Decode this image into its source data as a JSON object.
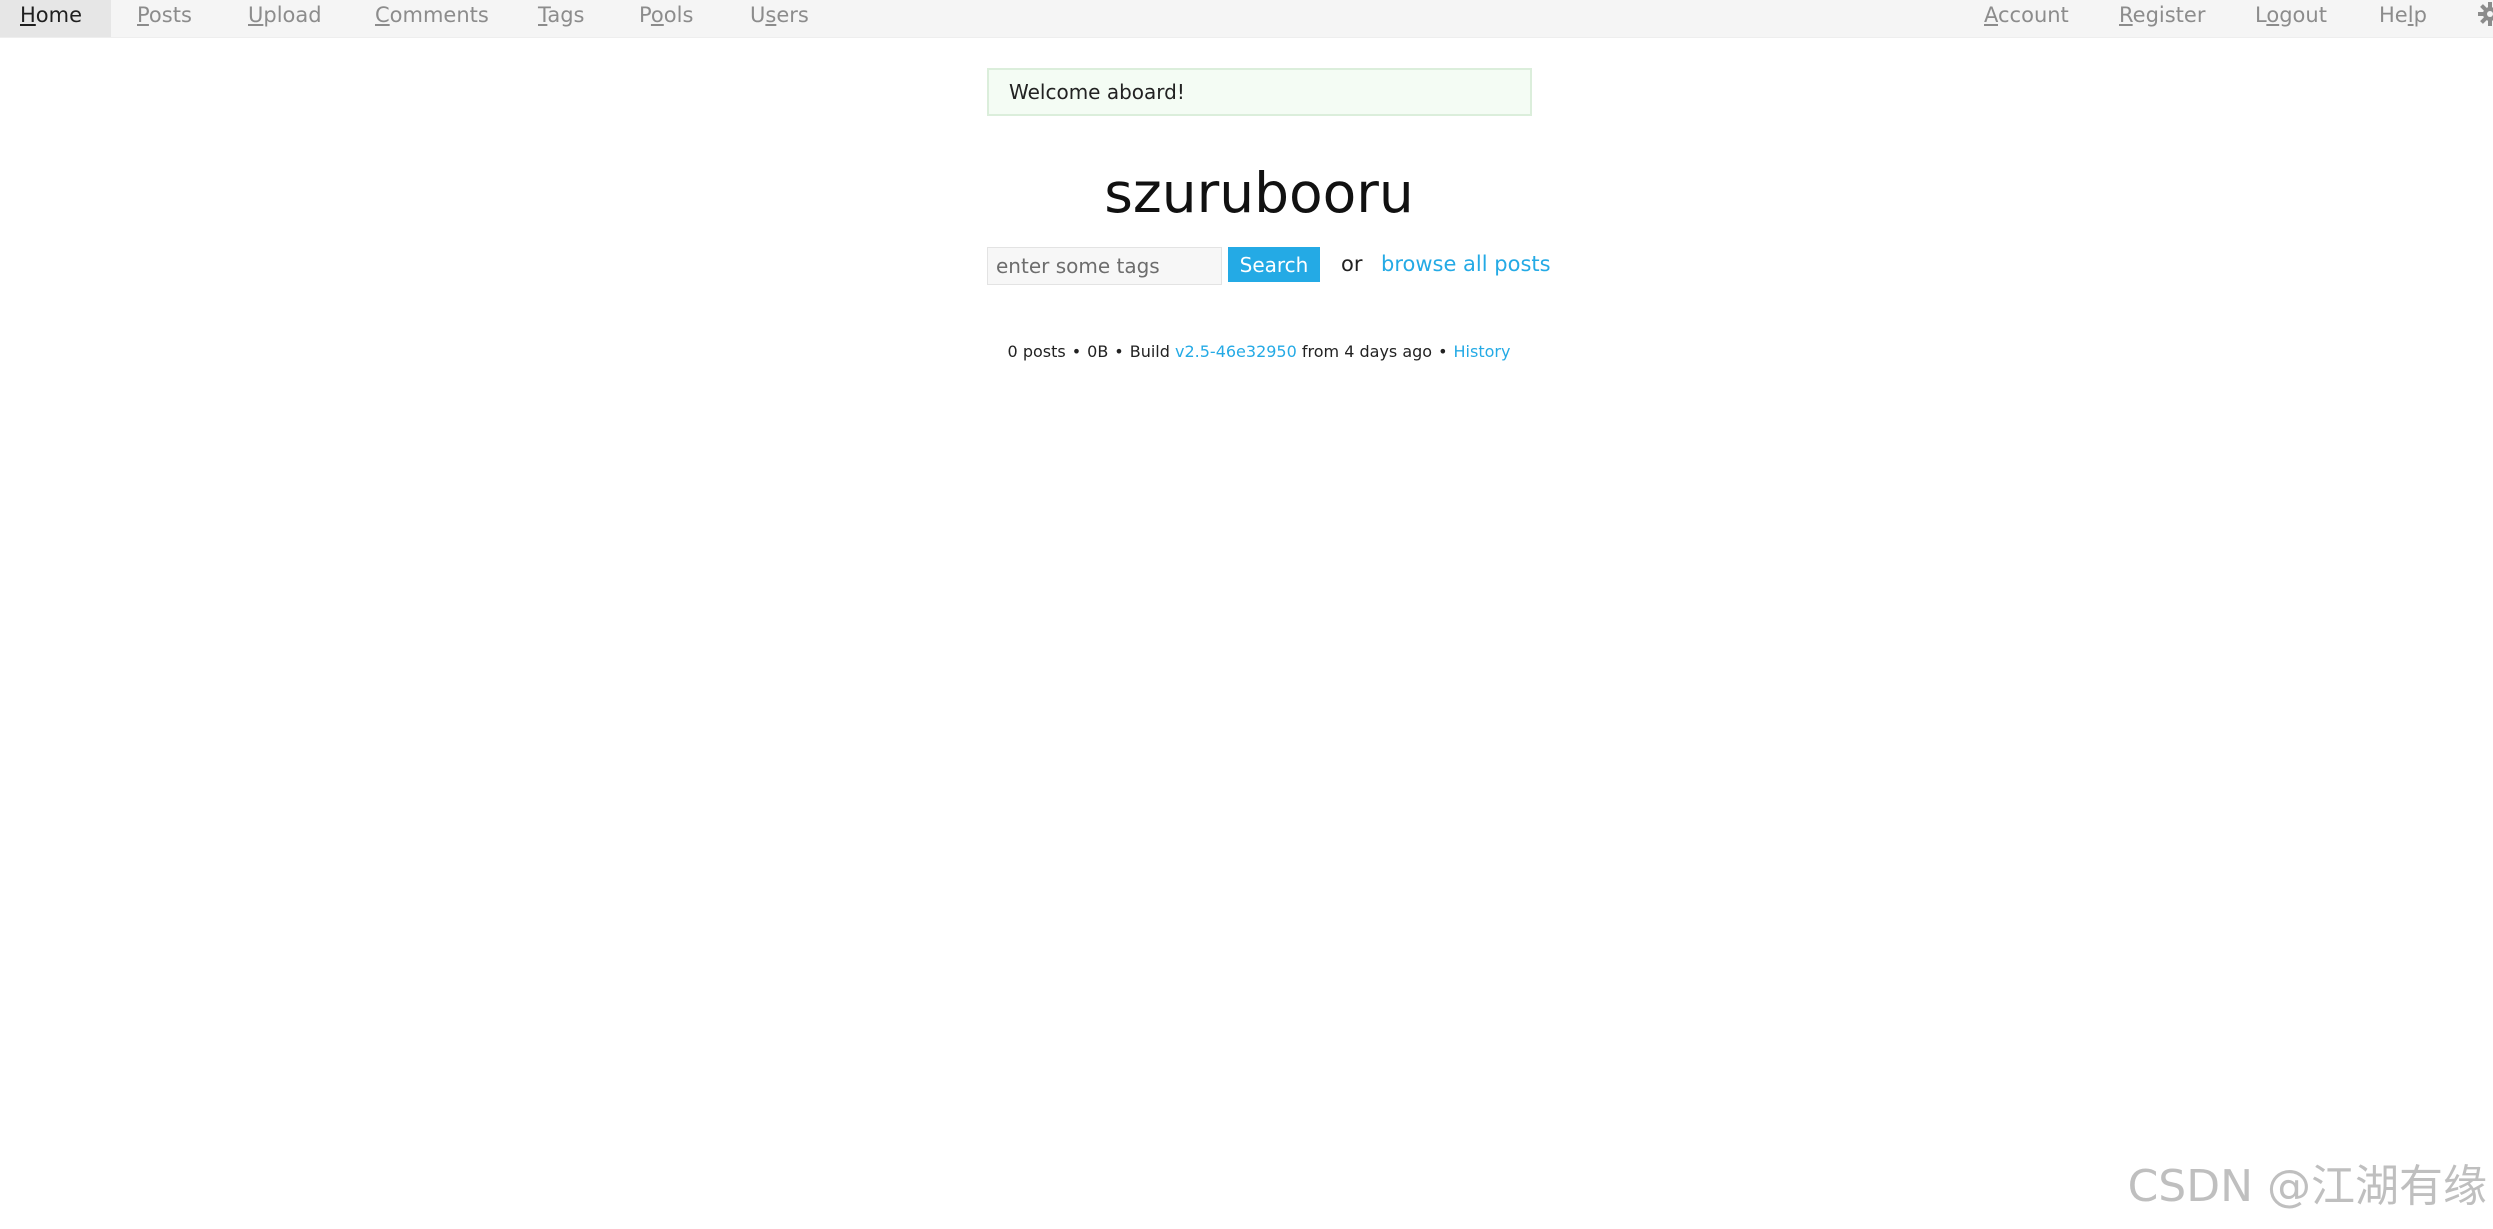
{
  "nav": {
    "left_items": [
      {
        "label_first": "H",
        "label_rest": "ome",
        "active": true
      },
      {
        "label_first": "P",
        "label_rest": "osts"
      },
      {
        "label_first": "U",
        "label_rest": "pload"
      },
      {
        "label_first": "C",
        "label_rest": "omments"
      },
      {
        "label_first": "T",
        "label_rest": "ags"
      },
      {
        "label_pre": "P",
        "label_first": "o",
        "label_rest": "ols"
      },
      {
        "label_pre": "U",
        "label_first": "s",
        "label_rest": "ers"
      }
    ],
    "right_items": [
      {
        "label_first": "A",
        "label_rest": "ccount"
      },
      {
        "label_first": "R",
        "label_rest": "egister"
      },
      {
        "label_pre": "L",
        "label_first": "o",
        "label_rest": "gout"
      },
      {
        "label_pre": "He",
        "label_first": "l",
        "label_rest": "p"
      }
    ],
    "settings_icon": "gear-icon"
  },
  "message": {
    "text": "Welcome aboard!"
  },
  "home": {
    "title": "szurubooru",
    "search_placeholder": "enter some tags",
    "search_button": "Search",
    "or_text": "or",
    "browse_link": "browse all posts"
  },
  "stats": {
    "posts": "0 posts",
    "size": "0B",
    "build_label": "Build",
    "build_version": "v2.5-46e32950",
    "build_age": "from 4 days ago",
    "history_link": "History",
    "separator": "•"
  },
  "watermark": "CSDN @江湖有缘",
  "colors": {
    "accent": "#24aae5",
    "nav_bg": "#f5f5f5",
    "message_bg": "#f4fcf4"
  }
}
